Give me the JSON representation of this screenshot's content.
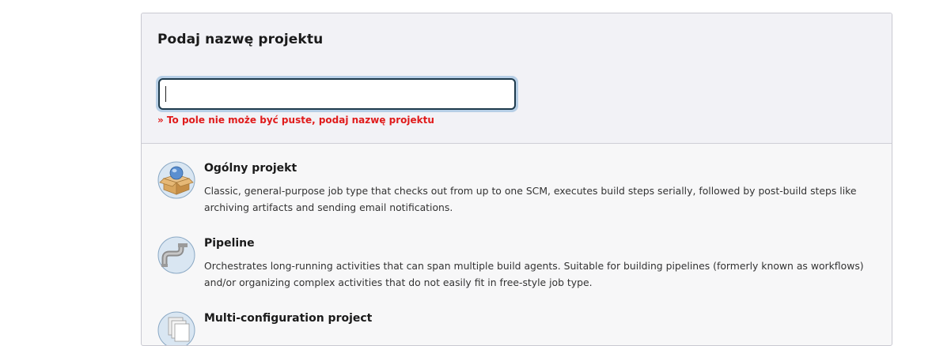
{
  "form": {
    "title": "Podaj nazwę projektu",
    "name_value": "",
    "error": "» To pole nie może być puste, podaj nazwę projektu"
  },
  "job_types": [
    {
      "title": "Ogólny projekt",
      "description": "Classic, general-purpose job type that checks out from up to one SCM, executes build steps serially, followed by post-build steps like archiving artifacts and sending email notifications.",
      "icon": "freestyle-package-icon"
    },
    {
      "title": "Pipeline",
      "description": "Orchestrates long-running activities that can span multiple build agents. Suitable for building pipelines (formerly known as workflows) and/or organizing complex activities that do not easily fit in free-style job type.",
      "icon": "pipeline-pipe-icon"
    },
    {
      "title": "Multi-configuration project",
      "description": "",
      "icon": "multi-configuration-icon"
    }
  ],
  "colors": {
    "error": "#e01b1b",
    "input_border": "#1e3a4c",
    "focus_ring": "#b7cfe6"
  }
}
